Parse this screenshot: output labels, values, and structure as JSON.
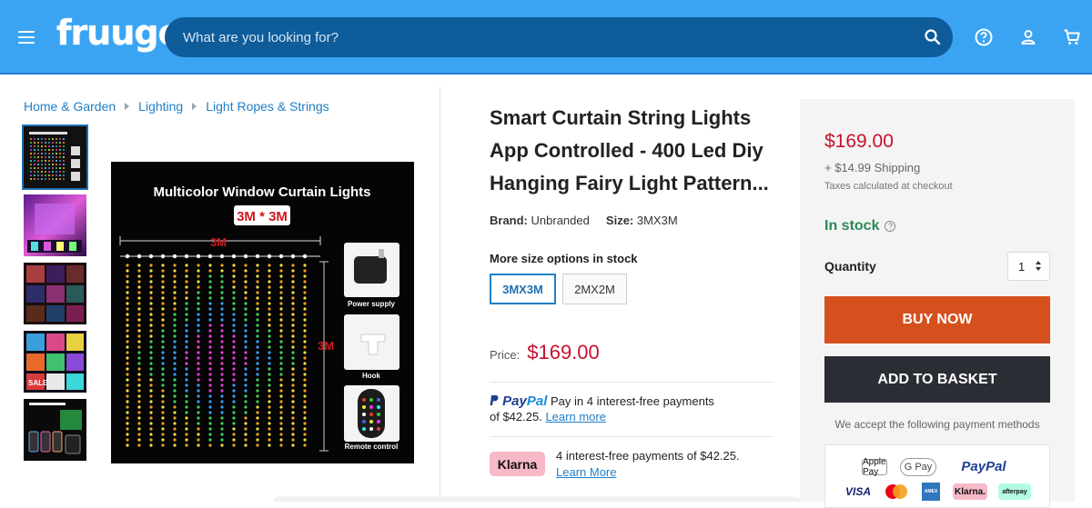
{
  "header": {
    "logo": "fruugo",
    "search_placeholder": "What are you looking for?",
    "icons": [
      "menu-icon",
      "search-icon",
      "help-icon",
      "account-icon",
      "basket-icon"
    ],
    "color": "#3aa4f2"
  },
  "breadcrumb": [
    "Home & Garden",
    "Lighting",
    "Light Ropes & Strings"
  ],
  "gallery": {
    "main_image": {
      "heading": "Multicolor Window Curtain Lights",
      "size_badge": "3M * 3M",
      "width_label": "3M",
      "height_label": "3M",
      "callouts": [
        "Power supply",
        "Hook",
        "Remote control"
      ]
    },
    "thumbnail_count": 5,
    "active_thumbnail": 0
  },
  "product": {
    "title": "Smart Curtain String Lights App Controlled - 400 Led Diy Hanging Fairy Light Pattern...",
    "brand_label": "Brand:",
    "brand": "Unbranded",
    "size_label": "Size:",
    "size": "3MX3M",
    "size_options_heading": "More size options in stock",
    "size_options": [
      "3MX3M",
      "2MX2M"
    ],
    "selected_size": "3MX3M",
    "price_label": "Price:",
    "price": "$169.00"
  },
  "paypal": {
    "logo_pay": "Pay",
    "logo_pal": "Pal",
    "text": "Pay in 4 interest-free payments",
    "amount_text": "of $42.25.",
    "link": "Learn more"
  },
  "klarna": {
    "badge": "Klarna",
    "text": "4 interest-free payments of $42.25.",
    "link": "Learn More"
  },
  "buy_box": {
    "price": "$169.00",
    "shipping": "+ $14.99 Shipping",
    "taxes": "Taxes calculated at checkout",
    "stock": "In stock",
    "quantity_label": "Quantity",
    "quantity": "1",
    "buy_now": "BUY NOW",
    "add_to_basket": "ADD TO BASKET",
    "accept_text": "We accept the following payment methods",
    "payment_methods": [
      "Apple Pay",
      "G Pay",
      "PayPal",
      "VISA",
      "Mastercard",
      "Amex",
      "Klarna.",
      "afterpay"
    ],
    "colors": {
      "price": "#c8102e",
      "stock": "#2a8a57",
      "buy_now": "#d5501d",
      "add_to_basket": "#2a2d33"
    }
  }
}
